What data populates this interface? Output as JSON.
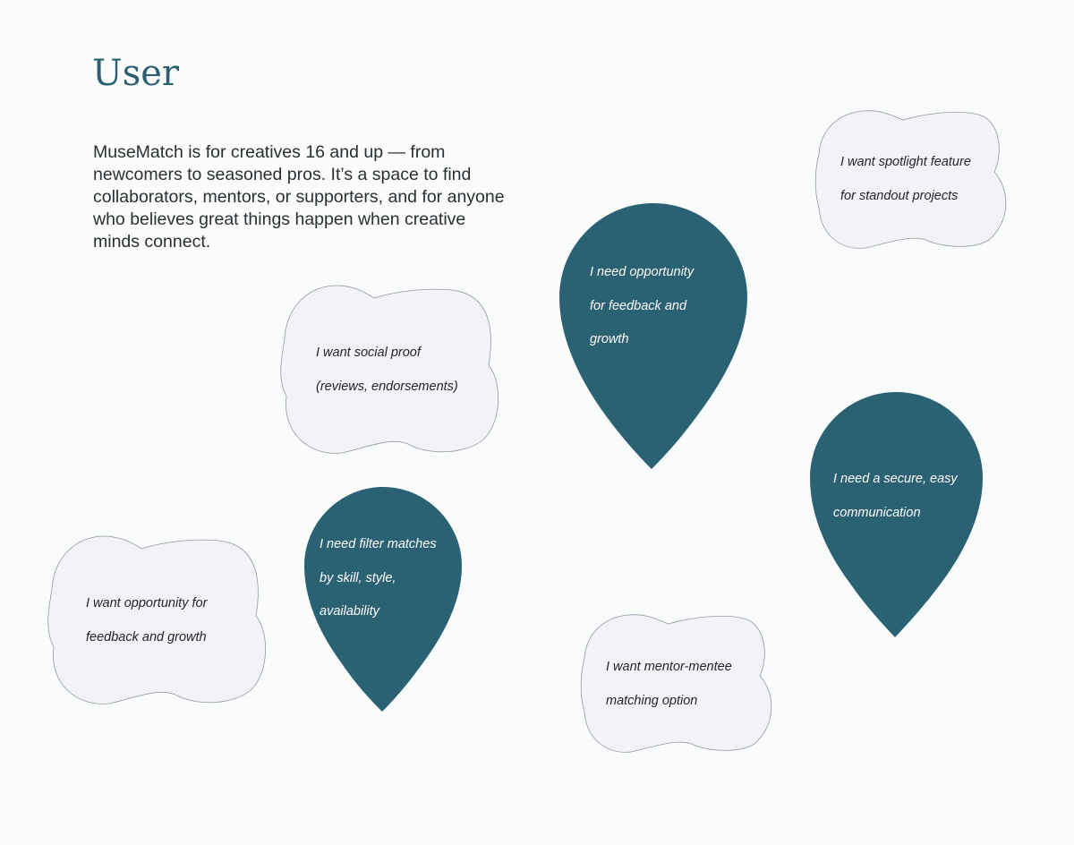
{
  "header": {
    "title": "User",
    "intro": "MuseMatch is for creatives 16 and up — from newcomers to seasoned pros. It’s a space to find collaborators, mentors, or supporters, and for anyone who believes great things happen when creative minds connect."
  },
  "colors": {
    "background": "#fafbfb",
    "title": "#2d5f72",
    "pin_fill": "#2a6273",
    "cloud_fill": "#f3f2f7",
    "cloud_stroke": "#8e9aa6"
  },
  "notes": {
    "spotlight": {
      "shape": "cloud",
      "text": "I want spotlight feature\nfor standout projects"
    },
    "feedback_need": {
      "shape": "pin",
      "text": "I need opportunity\nfor feedback and\ngrowth"
    },
    "social_proof": {
      "shape": "cloud",
      "text": "I want social proof\n(reviews, endorsements)"
    },
    "secure_communication": {
      "shape": "pin",
      "text": "I need a secure, easy\ncommunication"
    },
    "filter_matches": {
      "shape": "pin",
      "text": "I need filter matches\nby skill, style,\navailability"
    },
    "feedback_want": {
      "shape": "cloud",
      "text": "I want opportunity for\nfeedback and growth"
    },
    "mentor_matching": {
      "shape": "cloud",
      "text": "I want mentor-mentee\nmatching option"
    }
  }
}
